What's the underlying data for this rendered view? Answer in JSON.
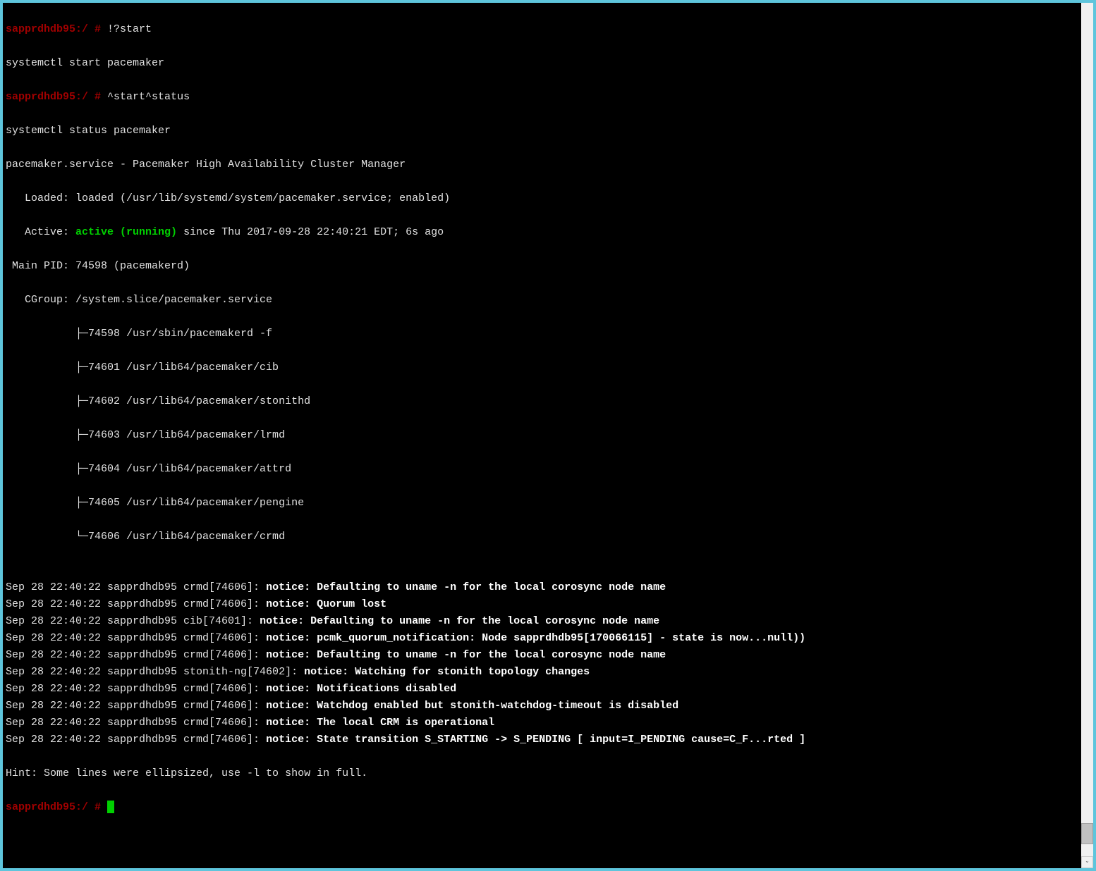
{
  "prompt": "sapprdhdb95:/ #",
  "cmd1": "!?start",
  "echo1": "systemctl start pacemaker",
  "cmd2": "^start^status",
  "echo2": "systemctl status pacemaker",
  "service_line": "pacemaker.service - Pacemaker High Availability Cluster Manager",
  "loaded_line": "   Loaded: loaded (/usr/lib/systemd/system/pacemaker.service; enabled)",
  "active_prefix": "   Active: ",
  "active_status": "active (running)",
  "active_suffix": " since Thu 2017-09-28 22:40:21 EDT; 6s ago",
  "mainpid_line": " Main PID: 74598 (pacemakerd)",
  "cgroup_line": "   CGroup: /system.slice/pacemaker.service",
  "proc1": "           ├─74598 /usr/sbin/pacemakerd -f",
  "proc2": "           ├─74601 /usr/lib64/pacemaker/cib",
  "proc3": "           ├─74602 /usr/lib64/pacemaker/stonithd",
  "proc4": "           ├─74603 /usr/lib64/pacemaker/lrmd",
  "proc5": "           ├─74604 /usr/lib64/pacemaker/attrd",
  "proc6": "           ├─74605 /usr/lib64/pacemaker/pengine",
  "proc7": "           └─74606 /usr/lib64/pacemaker/crmd",
  "blank": "",
  "logs": [
    {
      "pre": "Sep 28 22:40:22 sapprdhdb95 crmd[74606]: ",
      "bold": "notice: Defaulting to uname -n for the local corosync node name"
    },
    {
      "pre": "Sep 28 22:40:22 sapprdhdb95 crmd[74606]: ",
      "bold": "notice: Quorum lost"
    },
    {
      "pre": "Sep 28 22:40:22 sapprdhdb95 cib[74601]: ",
      "bold": "notice: Defaulting to uname -n for the local corosync node name"
    },
    {
      "pre": "Sep 28 22:40:22 sapprdhdb95 crmd[74606]: ",
      "bold": "notice: pcmk_quorum_notification: Node sapprdhdb95[170066115] - state is now...null))"
    },
    {
      "pre": "Sep 28 22:40:22 sapprdhdb95 crmd[74606]: ",
      "bold": "notice: Defaulting to uname -n for the local corosync node name"
    },
    {
      "pre": "Sep 28 22:40:22 sapprdhdb95 stonith-ng[74602]: ",
      "bold": "notice: Watching for stonith topology changes"
    },
    {
      "pre": "Sep 28 22:40:22 sapprdhdb95 crmd[74606]: ",
      "bold": "notice: Notifications disabled"
    },
    {
      "pre": "Sep 28 22:40:22 sapprdhdb95 crmd[74606]: ",
      "bold": "notice: Watchdog enabled but stonith-watchdog-timeout is disabled"
    },
    {
      "pre": "Sep 28 22:40:22 sapprdhdb95 crmd[74606]: ",
      "bold": "notice: The local CRM is operational"
    },
    {
      "pre": "Sep 28 22:40:22 sapprdhdb95 crmd[74606]: ",
      "bold": "notice: State transition S_STARTING -> S_PENDING [ input=I_PENDING cause=C_F...rted ]"
    }
  ],
  "hint": "Hint: Some lines were ellipsized, use -l to show in full."
}
